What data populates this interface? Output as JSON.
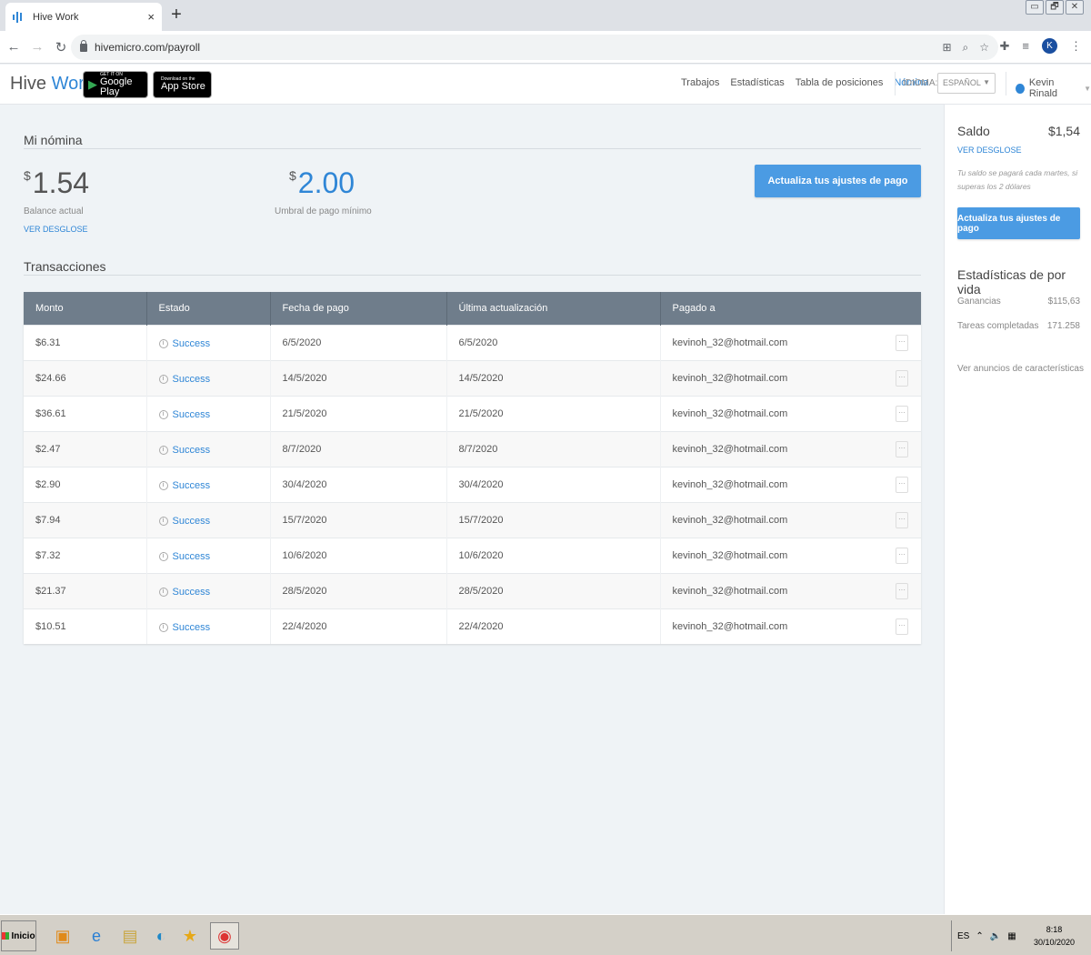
{
  "browser": {
    "tab_title": "Hive Work",
    "tab_close": "×",
    "new_tab": "+",
    "url": "hivemicro.com/payroll",
    "profile_initial": "K",
    "window_controls": [
      "▭",
      "🗗",
      "✕"
    ]
  },
  "header": {
    "brand_part1": "Hive ",
    "brand_part2": "Work",
    "google_play_small": "GET IT ON",
    "google_play_big": "Google Play",
    "app_store_small": "Download on the",
    "app_store_big": "App Store",
    "nav": [
      "Trabajos",
      "Estadísticas",
      "Tabla de posiciones",
      "Nómina"
    ],
    "language_label": "IDIOMA:",
    "language_value": "ESPAÑOL",
    "user_name": "Kevin Rinald"
  },
  "payroll": {
    "title": "Mi nómina",
    "currency_symbol": "$",
    "balance_value": "1.54",
    "balance_label": "Balance actual",
    "breakdown_link": "VER DESGLOSE",
    "threshold_value": "2.00",
    "threshold_label": "Umbral de pago mínimo",
    "update_button": "Actualiza tus ajustes de pago"
  },
  "transactions": {
    "title": "Transacciones",
    "columns": [
      "Monto",
      "Estado",
      "Fecha de pago",
      "Última actualización",
      "Pagado a"
    ],
    "rows": [
      {
        "amount": "$6.31",
        "status": "Success",
        "paid_date": "6/5/2020",
        "updated": "6/5/2020",
        "paid_to": "kevinoh_32@hotmail.com"
      },
      {
        "amount": "$24.66",
        "status": "Success",
        "paid_date": "14/5/2020",
        "updated": "14/5/2020",
        "paid_to": "kevinoh_32@hotmail.com"
      },
      {
        "amount": "$36.61",
        "status": "Success",
        "paid_date": "21/5/2020",
        "updated": "21/5/2020",
        "paid_to": "kevinoh_32@hotmail.com"
      },
      {
        "amount": "$2.47",
        "status": "Success",
        "paid_date": "8/7/2020",
        "updated": "8/7/2020",
        "paid_to": "kevinoh_32@hotmail.com"
      },
      {
        "amount": "$2.90",
        "status": "Success",
        "paid_date": "30/4/2020",
        "updated": "30/4/2020",
        "paid_to": "kevinoh_32@hotmail.com"
      },
      {
        "amount": "$7.94",
        "status": "Success",
        "paid_date": "15/7/2020",
        "updated": "15/7/2020",
        "paid_to": "kevinoh_32@hotmail.com"
      },
      {
        "amount": "$7.32",
        "status": "Success",
        "paid_date": "10/6/2020",
        "updated": "10/6/2020",
        "paid_to": "kevinoh_32@hotmail.com"
      },
      {
        "amount": "$21.37",
        "status": "Success",
        "paid_date": "28/5/2020",
        "updated": "28/5/2020",
        "paid_to": "kevinoh_32@hotmail.com"
      },
      {
        "amount": "$10.51",
        "status": "Success",
        "paid_date": "22/4/2020",
        "updated": "22/4/2020",
        "paid_to": "kevinoh_32@hotmail.com"
      }
    ]
  },
  "sidebar": {
    "balance_label": "Saldo",
    "balance_value": "$1,54",
    "breakdown_link": "VER DESGLOSE",
    "note": "Tu saldo se pagará cada martes, si superas los 2 dólares",
    "update_button": "Actualiza tus ajustes de pago",
    "lifetime_title": "Estadísticas de por vida",
    "earnings_label": "Ganancias",
    "earnings_value": "$115,63",
    "tasks_label": "Tareas completadas",
    "tasks_value": "171.258",
    "features_link": "Ver anuncios de características"
  },
  "taskbar": {
    "start_label": "Inicio",
    "language": "ES",
    "time": "8:18",
    "date": "30/10/2020"
  },
  "colors": {
    "accent": "#2f86d6",
    "button": "#4b9be3",
    "table_header": "#6f7d8b"
  }
}
